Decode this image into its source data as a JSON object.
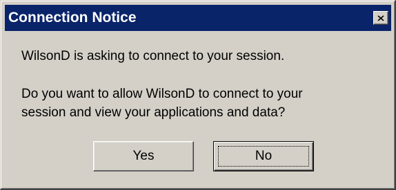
{
  "dialog": {
    "title": "Connection Notice",
    "close_icon": "close-icon",
    "message": "WilsonD is asking to connect to your session.",
    "question_lines": [
      "Do you want to allow WilsonD to connect to your",
      "session and view your applications and data?"
    ],
    "buttons": {
      "yes_label": "Yes",
      "no_label": "No"
    }
  },
  "colors": {
    "titlebar": "#0a246a",
    "face": "#d4d0c8"
  }
}
